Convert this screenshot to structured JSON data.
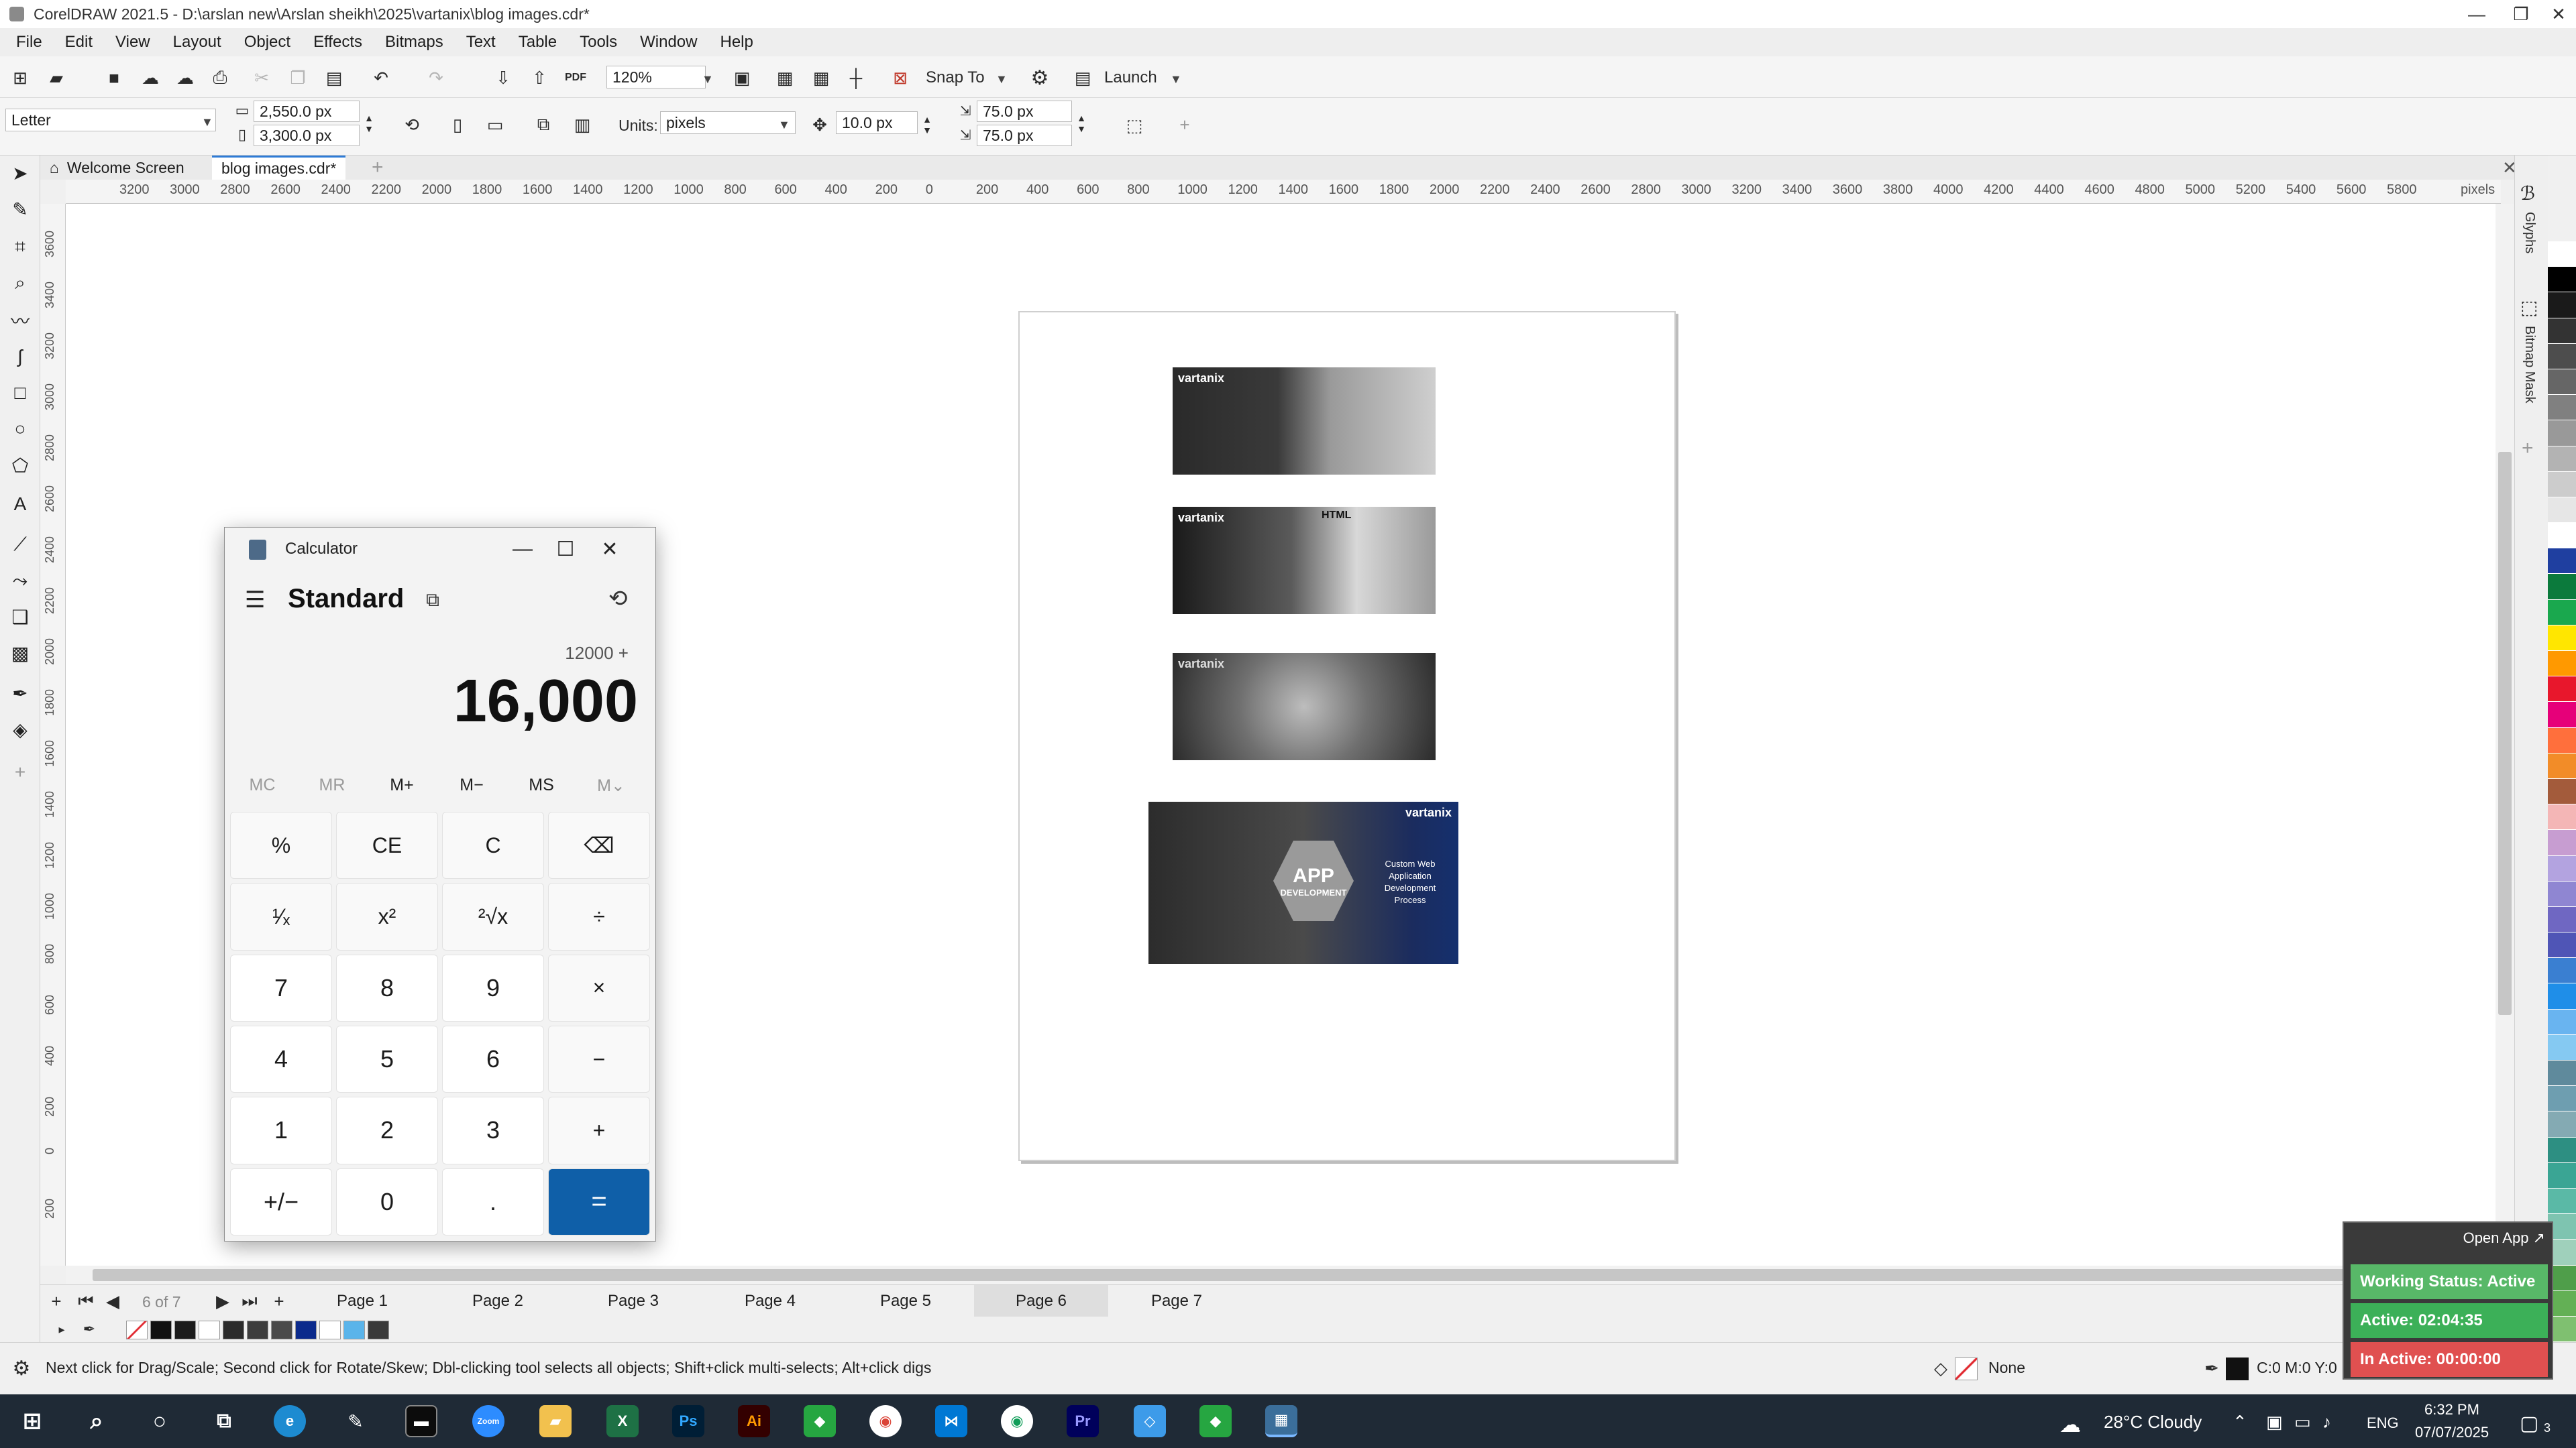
{
  "window": {
    "title": "CorelDRAW 2021.5 - D:\\arslan new\\Arslan sheikh\\2025\\vartanix\\blog images.cdr*",
    "minimize": "—",
    "maximize": "❐",
    "close": "✕"
  },
  "menu": [
    "File",
    "Edit",
    "View",
    "Layout",
    "Object",
    "Effects",
    "Bitmaps",
    "Text",
    "Table",
    "Tools",
    "Window",
    "Help"
  ],
  "toolbar": {
    "zoom": "120%",
    "snap_to": "Snap To",
    "launch": "Launch"
  },
  "property_bar": {
    "page_size": "Letter",
    "width": "2,550.0 px",
    "height": "3,300.0 px",
    "units_label": "Units:",
    "units": "pixels",
    "nudge": "10.0 px",
    "dup_x": "75.0 px",
    "dup_y": "75.0 px"
  },
  "tabs": [
    {
      "label": "Welcome Screen"
    },
    {
      "label": "blog images.cdr*"
    }
  ],
  "ruler": {
    "top_ticks": [
      "3200",
      "3000",
      "2800",
      "2600",
      "2400",
      "2200",
      "2000",
      "1800",
      "1600",
      "1400",
      "1200",
      "1000",
      "800",
      "600",
      "400",
      "200",
      "0",
      "200",
      "400",
      "600",
      "800",
      "1000",
      "1200",
      "1400",
      "1600",
      "1800",
      "2000",
      "2200",
      "2400",
      "2600",
      "2800",
      "3000",
      "3200",
      "3400",
      "3600",
      "3800",
      "4000",
      "4200",
      "4400",
      "4600",
      "4800",
      "5000",
      "5200",
      "5400",
      "5600",
      "5800"
    ],
    "unit": "pixels",
    "left_ticks": [
      "3600",
      "3400",
      "3200",
      "3000",
      "2800",
      "2600",
      "2400",
      "2200",
      "2000",
      "1800",
      "1600",
      "1400",
      "1200",
      "1000",
      "800",
      "600",
      "400",
      "200",
      "0",
      "200"
    ]
  },
  "canvas_images": [
    {
      "logo": "vartanix"
    },
    {
      "logo": "vartanix",
      "caption": "HTML"
    },
    {
      "logo": "vartanix"
    },
    {
      "logo": "vartanix",
      "title": "APP",
      "subtitle": "DEVELOPMENT",
      "side_text": "Custom Web Application Development Process"
    }
  ],
  "dockers": [
    "Glyphs",
    "Bitmap Mask"
  ],
  "pages": {
    "counter": "6 of 7",
    "tabs": [
      "Page 1",
      "Page 2",
      "Page 3",
      "Page 4",
      "Page 5",
      "Page 6",
      "Page 7"
    ],
    "active": "Page 6"
  },
  "status": {
    "hint": "Next click for Drag/Scale; Second click for Rotate/Skew; Dbl-clicking tool selects all objects; Shift+click multi-selects; Alt+click digs",
    "fill": "None",
    "outline": "C:0 M:0 Y:0 K:100"
  },
  "calculator": {
    "title": "Calculator",
    "mode": "Standard",
    "expression": "12000 +",
    "display": "16,000",
    "memory": [
      "MC",
      "MR",
      "M+",
      "M−",
      "MS",
      "M⌄"
    ],
    "keys": [
      "%",
      "CE",
      "C",
      "⌫",
      "¹⁄ₓ",
      "x²",
      "²√x",
      "÷",
      "7",
      "8",
      "9",
      "×",
      "4",
      "5",
      "6",
      "−",
      "1",
      "2",
      "3",
      "+",
      "+/−",
      "0",
      ".",
      "="
    ]
  },
  "tracker": {
    "open_app": "Open App ↗",
    "working_status": "Working Status: Active",
    "active_time": "Active: 02:04:35",
    "inactive_time": "In Active: 00:00:00",
    "colors": {
      "status": "#58b868",
      "active": "#3cb058",
      "inactive": "#e05050"
    }
  },
  "taskbar": {
    "weather": "28°C  Cloudy",
    "language": "ENG",
    "time": "6:32 PM",
    "date": "07/07/2025",
    "notifications": "3",
    "apps": [
      "Zoom",
      "Ps",
      "Ai",
      "Pr"
    ]
  },
  "palette_colors": [
    "#ffffff",
    "#000000",
    "#1a1a1a",
    "#333333",
    "#4d4d4d",
    "#666666",
    "#808080",
    "#999999",
    "#b3b3b3",
    "#cccccc",
    "#e6e6e6",
    "#ffffff",
    "#1f3fa0",
    "#0b7a3c",
    "#1aa84e",
    "#ffe600",
    "#ff9900",
    "#e8172c",
    "#e60079",
    "#ff6f3c",
    "#f28c28",
    "#a35b3b",
    "#f4b6b6",
    "#c79dd1",
    "#b3a3e0",
    "#8f86d2",
    "#6f67c2",
    "#4f55b6",
    "#3a7fd1",
    "#1f8ee8",
    "#69b4f0",
    "#85c9f2",
    "#5f8a9c",
    "#6e9eb0",
    "#84aab3",
    "#2d8f82",
    "#3aa594",
    "#5ab9a6",
    "#7ec4b0",
    "#9fd0bb",
    "#4f9e4a",
    "#63b055",
    "#7fc070",
    "#a4d18e"
  ]
}
